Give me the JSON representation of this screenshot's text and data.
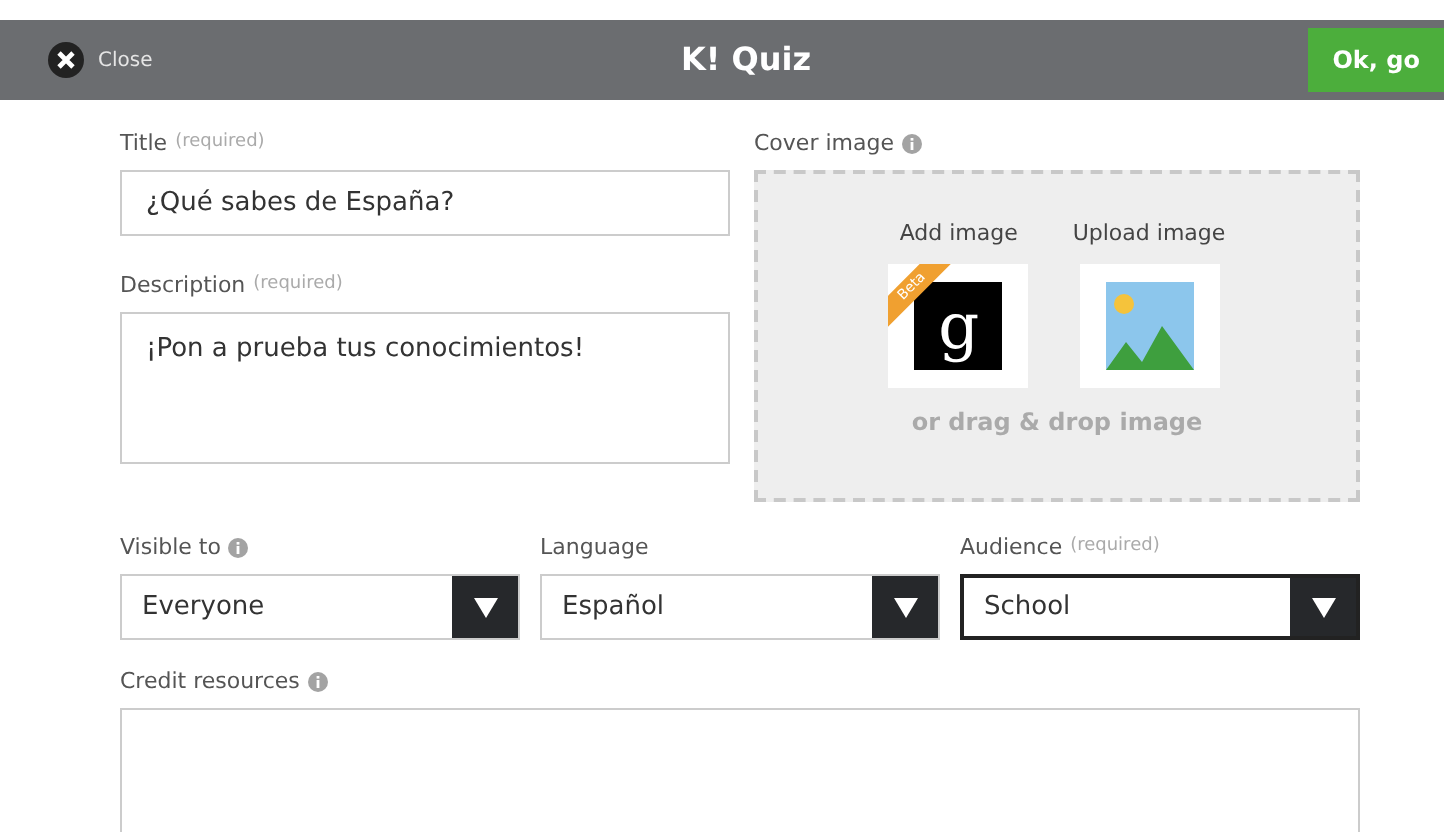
{
  "header": {
    "close_label": "Close",
    "title": "K! Quiz",
    "confirm_button": "Ok, go"
  },
  "title_field": {
    "label": "Title",
    "hint": "(required)",
    "value": "¿Qué sabes de España?"
  },
  "description_field": {
    "label": "Description",
    "hint": "(required)",
    "value": "¡Pon a prueba tus conocimientos!"
  },
  "cover_image": {
    "label": "Cover image",
    "options": [
      {
        "kind": "gallery",
        "label": "Add image",
        "badge": "Beta",
        "glyph": "g"
      },
      {
        "kind": "upload",
        "label": "Upload image"
      }
    ],
    "drop_text": "or drag & drop image"
  },
  "selects": [
    {
      "label": "Visible to",
      "info": true,
      "value": "Everyone",
      "focused": false
    },
    {
      "label": "Language",
      "info": false,
      "value": "Español",
      "focused": false
    },
    {
      "label": "Audience",
      "hint": "(required)",
      "info": false,
      "value": "School",
      "focused": true
    }
  ],
  "credit_field": {
    "label": "Credit resources",
    "info": true
  }
}
